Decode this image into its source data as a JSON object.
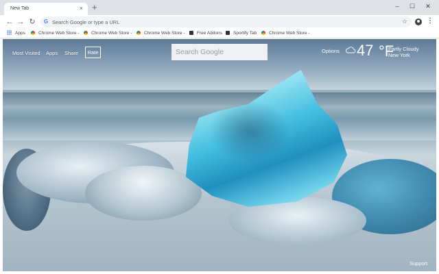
{
  "browser": {
    "tab_title": "New Tab",
    "tab_close": "×",
    "new_tab": "+",
    "window_controls": [
      "–",
      "☐",
      "✕"
    ]
  },
  "toolbar": {
    "back": "←",
    "forward": "→",
    "reload": "↻",
    "omnibox_placeholder": "Search Google or type a URL",
    "google_glyph": "G",
    "star": "☆",
    "menu": "⋮"
  },
  "bookmarks": [
    {
      "label": "Apps",
      "icon": "apps-grid-icon"
    },
    {
      "label": "Chrome Web Store -",
      "icon": "chrome-web-store-icon"
    },
    {
      "label": "Chrome Web Store -",
      "icon": "chrome-web-store-icon"
    },
    {
      "label": "Chrome Web Store -",
      "icon": "chrome-web-store-icon"
    },
    {
      "label": "Free Addons",
      "icon": "addon-icon"
    },
    {
      "label": "Sportify Tab",
      "icon": "addon-icon"
    },
    {
      "label": "Chrome Web Store -",
      "icon": "chrome-web-store-icon"
    }
  ],
  "newtab": {
    "nav": {
      "most_visited": "Most Visited",
      "apps": "Apps",
      "share": "Share",
      "rate": "Rate"
    },
    "search_placeholder": "Search Google",
    "options": "Options",
    "weather": {
      "temperature": "47",
      "unit": "°F",
      "condition": "Partly Cloudy",
      "city": "New York",
      "icon": "cloud-icon"
    },
    "support": "Support"
  },
  "colors": {
    "titlebar": "#dee1e6",
    "omnibox": "#f1f3f4",
    "ice_blue": "#45bfe0"
  }
}
